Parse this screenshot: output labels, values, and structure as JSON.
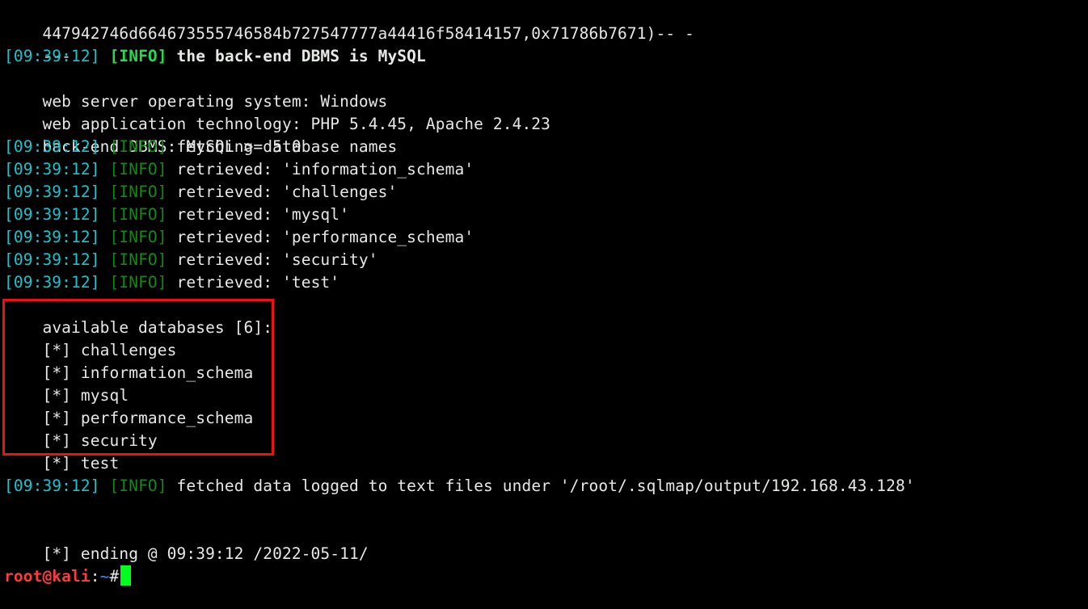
{
  "terminal": {
    "app": "sqlmap",
    "shell_host": "kali",
    "colors": {
      "background": "#000000",
      "foreground": "#d8dee9",
      "timestamp_cyan": "#13c6cf",
      "info_bright_green": "#22dd4a",
      "info_dark_green": "#0f8a14",
      "prompt_red": "#ff3b3b",
      "prompt_blue": "#3a8ee6",
      "cursor_green": "#00ff1e",
      "highlight_box_red": "#ee1111"
    },
    "lines": {
      "payload_tail": "447942746d664673555746584b727547777a44416f58414157,0x71786b7671)-- -",
      "separator": "---",
      "dbms_info": {
        "timestamp": "[09:39:12]",
        "level": "[INFO]",
        "message": "the back-end DBMS is MySQL"
      },
      "web_server_os": "web server operating system: Windows",
      "web_app_tech": "web application technology: PHP 5.4.45, Apache 2.4.23",
      "back_end_dbms": "back-end DBMS: MySQL >= 5.0",
      "fetching": {
        "timestamp": "[09:39:12]",
        "level": "[INFO]",
        "message": "fetching database names"
      },
      "retrieved": [
        {
          "timestamp": "[09:39:12]",
          "level": "[INFO]",
          "message": "retrieved: 'information_schema'"
        },
        {
          "timestamp": "[09:39:12]",
          "level": "[INFO]",
          "message": "retrieved: 'challenges'"
        },
        {
          "timestamp": "[09:39:12]",
          "level": "[INFO]",
          "message": "retrieved: 'mysql'"
        },
        {
          "timestamp": "[09:39:12]",
          "level": "[INFO]",
          "message": "retrieved: 'performance_schema'"
        },
        {
          "timestamp": "[09:39:12]",
          "level": "[INFO]",
          "message": "retrieved: 'security'"
        },
        {
          "timestamp": "[09:39:12]",
          "level": "[INFO]",
          "message": "retrieved: 'test'"
        }
      ],
      "available_databases": {
        "header": "available databases [6]:",
        "count": 6,
        "marker": "[*]",
        "items": [
          "[*] challenges",
          "[*] information_schema",
          "[*] mysql",
          "[*] performance_schema",
          "[*] security",
          "[*] test"
        ]
      },
      "fetched_logged": {
        "timestamp": "[09:39:12]",
        "level": "[INFO]",
        "message": "fetched data logged to text files under '/root/.sqlmap/output/192.168.43.128'"
      },
      "ending": "[*] ending @ 09:39:12 /2022-05-11/"
    },
    "prompt": {
      "user_host": "root@kali",
      "colon": ":",
      "path": "~",
      "sigil": "#",
      "command": ""
    }
  }
}
